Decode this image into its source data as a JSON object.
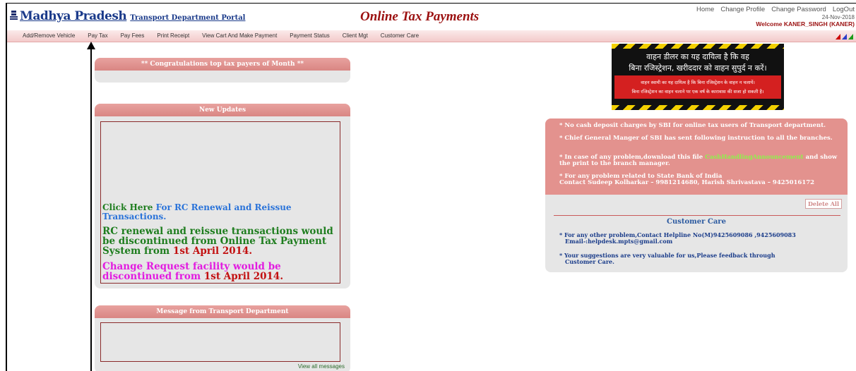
{
  "header": {
    "logo_title": "Madhya Pradesh",
    "logo_subtitle": "Transport Department Portal",
    "page_title": "Online Tax Payments",
    "links": [
      "Home",
      "Change Profile",
      "Change Password",
      "LogOut"
    ],
    "date": "24-Nov-2018",
    "welcome": "Welcome  KANER_SINGH (KANER)"
  },
  "nav": {
    "items": [
      "Add/Remove Vehicle",
      "Pay Tax",
      "Pay Fees",
      "Print Receipt",
      "View Cart And Make Payment",
      "Payment Status",
      "Client Mgt",
      "Customer Care"
    ]
  },
  "panels": {
    "top_payers": "** Congratulations top tax payers of Month **",
    "updates": {
      "title": "New Updates",
      "click_here": "Click Here",
      "rc_link": " For RC Renewal and Reissue Transactions.",
      "line2_text": "RC renewal and reissue transactions would be discontinued from Online Tax Payment System from ",
      "line2_date": "1st April 2014.",
      "line3_text": "Change Request facility would be discontinued from ",
      "line3_date": "1st April 2014."
    },
    "message": {
      "title": "Message from Transport Department",
      "view_all": "View all messages"
    }
  },
  "banner": {
    "line1": "वाहन डीलर का यह दायित्व है कि वह",
    "line2": "बिना रजिस्ट्रेशन, खरीददार को वाहन सुपुर्द न करें।",
    "red_line1": "वाहन स्वामी का यह दायित्व है कि बिना रजिस्ट्रेशन के वाहन न चलायें।",
    "red_line2": "बिना रजिस्ट्रेशन का वाहन चलाने पर एक वर्ष के कारावास की सजा हो सकती है।"
  },
  "notice": {
    "item1": "* No cash deposit charges by SBI for online tax users of Transport department.",
    "item2": "* Chief General Manger of SBI has sent following instruction to all the branches.",
    "item3_pre": "* In case of any problem,download this file ",
    "item3_link": "CashHandlingAnnouncement",
    "item3_post": " and show the print to the branch manager.",
    "item4_l1": "* For any problem related to State Bank of India",
    "item4_l2": "Contact Sudeep Kolharkar – 9981214680, Harish Shrivastava – 9425016172",
    "delete_label": "Delete All"
  },
  "customer_care": {
    "title": "Customer Care",
    "item1_l1": "* For any other problem,Contact Helpline No(M)9425609086 ,9425609083",
    "item1_l2": "Email-:helpdesk.mpts@gmail.com",
    "item2_l1": "* Your suggestions are very valuable for us,Please feedback through",
    "item2_l2": "Customer Care."
  },
  "colors": {
    "brand_blue": "#1a3a8a",
    "title_red": "#9b1010",
    "panel_header": "#d98683",
    "notice_bg": "#e3928e",
    "highlight_green": "#8df24a"
  }
}
